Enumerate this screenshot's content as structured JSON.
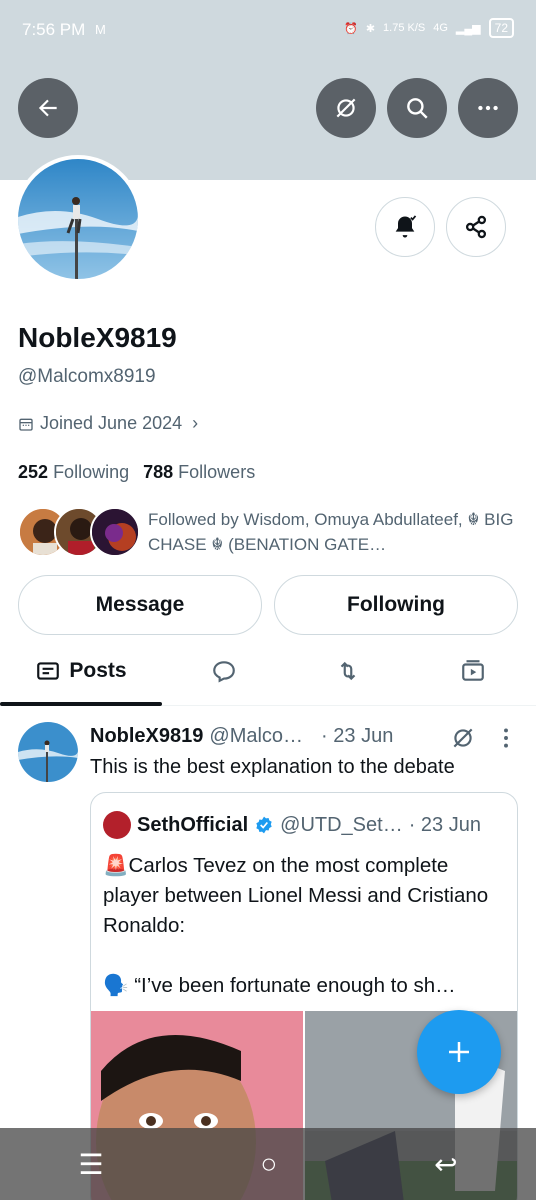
{
  "status_bar": {
    "time": "7:56 PM",
    "mail_icon": "M",
    "speed": "1.75 K/S",
    "network": "4G",
    "battery": "72"
  },
  "profile": {
    "name": "NobleX9819",
    "handle": "@Malcomx8919",
    "joined": "Joined June 2024",
    "following_count": "252",
    "following_label": "Following",
    "followers_count": "788",
    "followers_label": "Followers",
    "followed_by": "Followed by Wisdom, Omuya Abdullateef, ☬ BIG CHASE ☬ (BENATION GATE…"
  },
  "actions": {
    "message": "Message",
    "following": "Following"
  },
  "tabs": {
    "posts": "Posts"
  },
  "post": {
    "name": "NobleX9819",
    "handle": "@Malco…",
    "date": "· 23 Jun",
    "text": "This is the best explanation to the debate",
    "quote": {
      "name": "SethOfficial",
      "handle": "@UTD_Set…",
      "date": "· 23 Jun",
      "line1": "🚨Carlos Tevez on the most complete player between Lionel Messi and Cristiano Ronaldo:",
      "line2": "🗣️ “I’ve been fortunate enough to sh…"
    }
  },
  "colors": {
    "accent": "#1d9bf0",
    "banner": "#cfd9de",
    "text": "#0f1419",
    "secondary": "#536471"
  }
}
